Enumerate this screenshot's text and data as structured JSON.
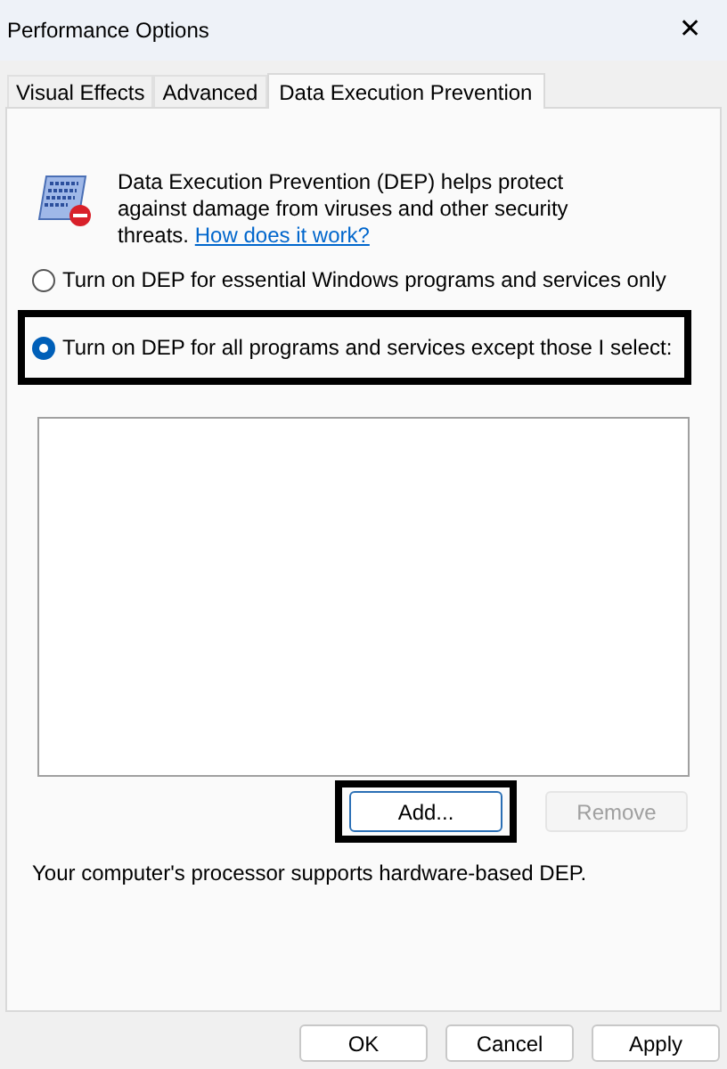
{
  "window": {
    "title": "Performance Options",
    "close": "✕"
  },
  "tabs": [
    {
      "label": "Visual Effects",
      "selected": false
    },
    {
      "label": "Advanced",
      "selected": false
    },
    {
      "label": "Data Execution Prevention",
      "selected": true
    }
  ],
  "description": {
    "text": "Data Execution Prevention (DEP) helps protect against damage from viruses and other security threats.",
    "link": "How does it work?"
  },
  "options": [
    {
      "label": "Turn on DEP for essential Windows programs and services only",
      "selected": false,
      "highlighted": false
    },
    {
      "label": "Turn on DEP for all programs and services except those I select:",
      "selected": true,
      "highlighted": true
    }
  ],
  "list_buttons": [
    {
      "label": "Add...",
      "disabled": false,
      "highlighted": true
    },
    {
      "label": "Remove",
      "disabled": true,
      "highlighted": false
    }
  ],
  "status": "Your computer's processor supports hardware-based DEP.",
  "dialog_buttons": [
    {
      "label": "OK"
    },
    {
      "label": "Cancel"
    },
    {
      "label": "Apply"
    }
  ]
}
